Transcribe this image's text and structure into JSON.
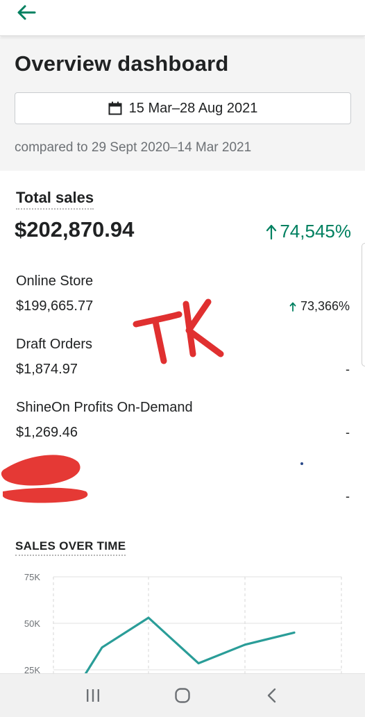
{
  "header": {
    "title": "Overview dashboard",
    "date_range": "15 Mar–28 Aug 2021",
    "compared_to": "compared to 29 Sept 2020–14 Mar 2021"
  },
  "total_sales": {
    "label": "Total sales",
    "value": "$202,870.94",
    "change": "74,545%",
    "change_color": "#008060"
  },
  "channels": [
    {
      "name": "Online Store",
      "value": "$199,665.77",
      "change": "73,366%"
    },
    {
      "name": "Draft Orders",
      "value": "$1,874.97",
      "change": "-"
    },
    {
      "name": "ShineOn Profits On-Demand",
      "value": "$1,269.46",
      "change": "-"
    },
    {
      "name": "",
      "value": "",
      "change": "-"
    }
  ],
  "watermark": "TK",
  "sales_over_time": {
    "heading": "SALES OVER TIME"
  },
  "chart_data": {
    "type": "line",
    "title": "SALES OVER TIME",
    "xlabel": "",
    "ylabel": "",
    "y_ticks": [
      "75K",
      "50K",
      "25K"
    ],
    "ylim": [
      0,
      75000
    ],
    "grid": true,
    "series": [
      {
        "values": [
          15000,
          37000,
          53000,
          28500,
          38500,
          45000
        ],
        "color": "#2a9d98"
      }
    ]
  },
  "icons": {
    "back": "arrow-left-icon",
    "date": "calendar-icon",
    "up": "arrow-up-icon",
    "nav_recents": "recent-apps-icon",
    "nav_home": "home-icon",
    "nav_back": "chevron-left-icon"
  },
  "colors": {
    "accent": "#008060",
    "watermark": "#e03030",
    "redaction": "#e53935"
  }
}
